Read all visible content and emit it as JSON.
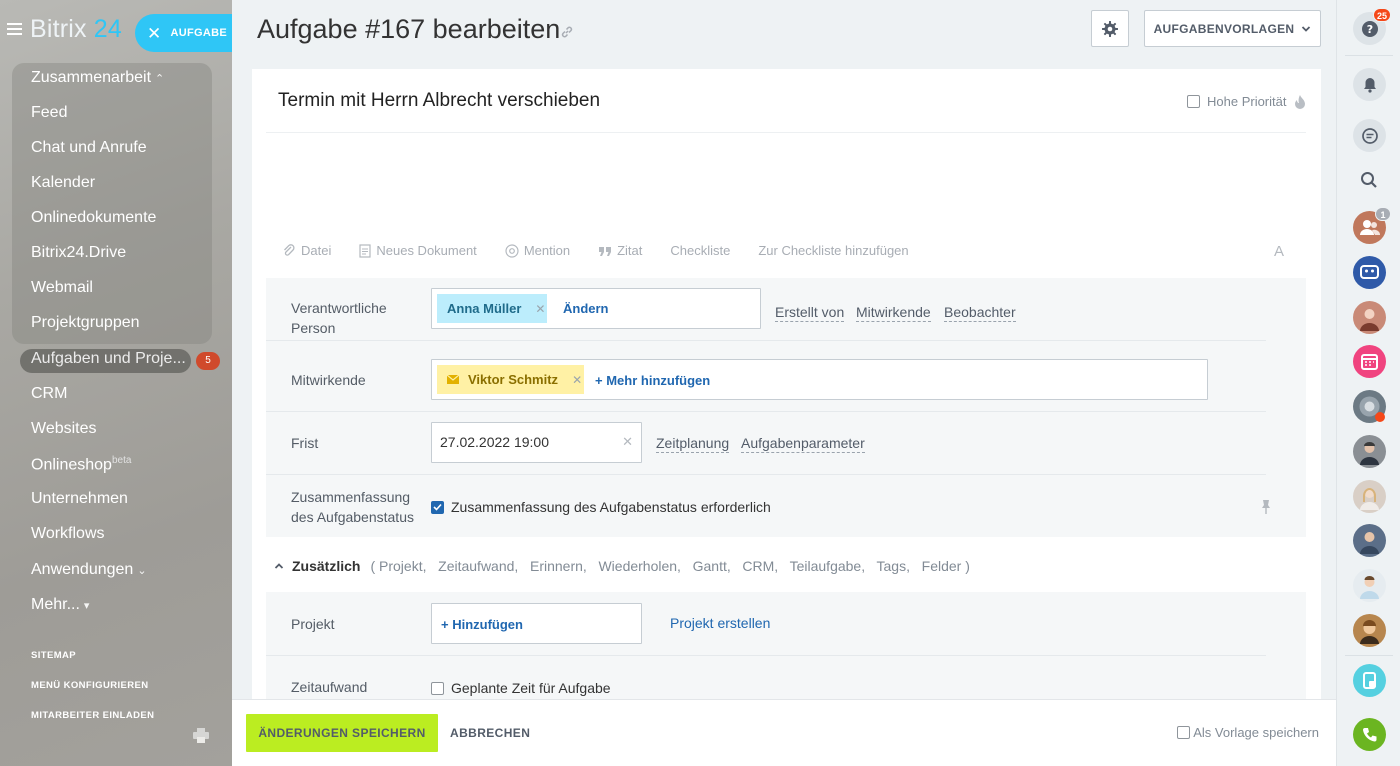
{
  "sidebar": {
    "logo_text": "Bitrix",
    "logo_number": "24",
    "new_task_button": "AUFGABE",
    "menu_items": [
      {
        "label": "Zusammenarbeit",
        "chevron": "⌃"
      },
      {
        "label": "Feed"
      },
      {
        "label": "Chat und Anrufe"
      },
      {
        "label": "Kalender"
      },
      {
        "label": "Onlinedokumente"
      },
      {
        "label": "Bitrix24.Drive"
      },
      {
        "label": "Webmail"
      },
      {
        "label": "Projektgruppen"
      },
      {
        "label": "Aufgaben und Proje...",
        "badge": "5"
      },
      {
        "label": "CRM"
      },
      {
        "label": "Websites"
      },
      {
        "label": "Onlineshop",
        "sup": "beta"
      },
      {
        "label": "Unternehmen"
      },
      {
        "label": "Workflows"
      },
      {
        "label": "Anwendungen",
        "chevron": "⌄"
      },
      {
        "label": "Mehr...",
        "chevron": "▾"
      }
    ],
    "links": [
      "SITEMAP",
      "MENÜ KONFIGURIEREN",
      "MITARBEITER EINLADEN"
    ]
  },
  "header": {
    "title": "Aufgabe #167 bearbeiten",
    "templates_button": "AUFGABENVORLAGEN"
  },
  "task": {
    "title_value": "Termin mit Herrn  Albrecht verschieben",
    "high_priority_label": "Hohe Priorität"
  },
  "toolbar": {
    "items": [
      "Datei",
      "Neues Dokument",
      "Mention",
      "Zitat",
      "Checkliste",
      "Zur Checkliste hinzufügen"
    ],
    "font_button": "A"
  },
  "form": {
    "responsible_label": "Verantwortliche Person",
    "responsible_chip": "Anna Müller",
    "responsible_change": "Ändern",
    "role_links": [
      "Erstellt von",
      "Mitwirkende",
      "Beobachter"
    ],
    "participants_label": "Mitwirkende",
    "participant_chip": "Viktor Schmitz",
    "add_more": "Mehr hinzufügen",
    "deadline_label": "Frist",
    "deadline_value": "27.02.2022 19:00",
    "deadline_links": [
      "Zeitplanung",
      "Aufgabenparameter"
    ],
    "summary_label": "Zusammenfassung des Aufgabenstatus",
    "summary_checkbox": "Zusammenfassung des Aufgabenstatus erforderlich",
    "extra_head": "Zusätzlich",
    "extra_items": "( Projekt,   Zeitaufwand,   Erinnern,   Wiederholen,   Gantt,   CRM,   Teilaufgabe,   Tags,   Felder )",
    "project_label": "Projekt",
    "project_add": "Hinzufügen",
    "project_create": "Projekt erstellen",
    "time_label": "Zeitaufwand",
    "time_checkbox": "Geplante Zeit für Aufgabe"
  },
  "footer": {
    "save": "ÄNDERUNGEN SPEICHERN",
    "cancel": "ABBRECHEN",
    "save_template": "Als Vorlage speichern"
  },
  "rightbar": {
    "help_badge": "25",
    "group_badge": "1"
  },
  "colors": {
    "accent": "#2fc6f6",
    "save_green": "#bbed21",
    "link_blue": "#2067b0",
    "badge_red": "#d04a2c"
  }
}
